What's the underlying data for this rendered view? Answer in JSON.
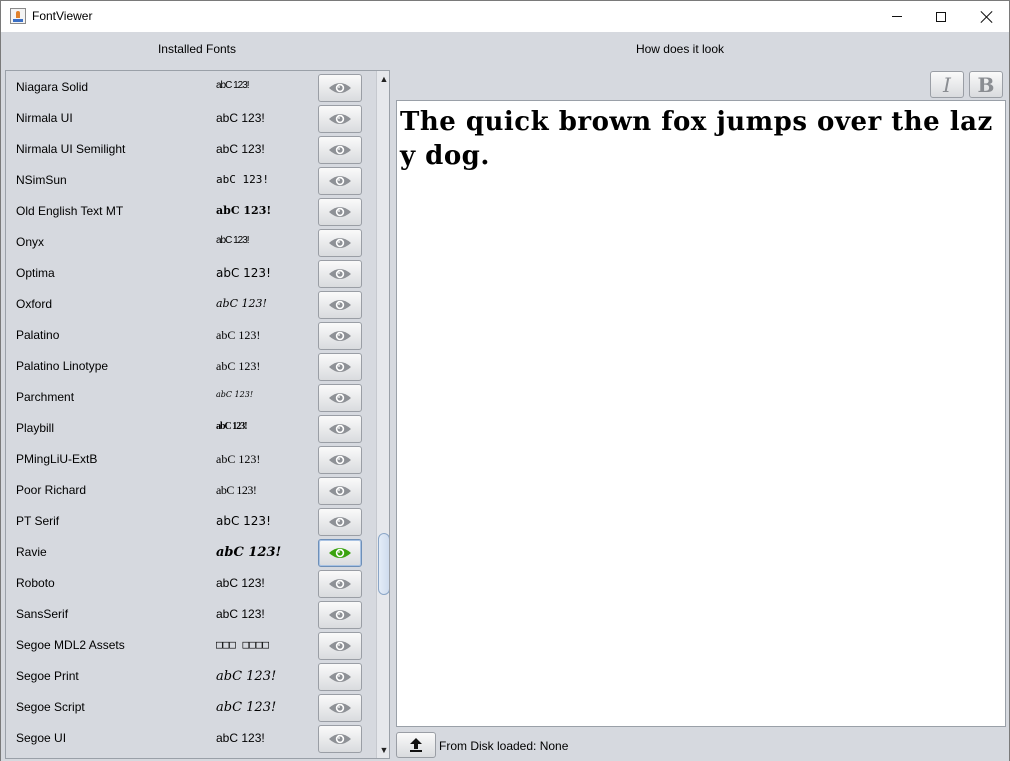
{
  "window": {
    "title": "FontViewer"
  },
  "headers": {
    "left": "Installed Fonts",
    "right": "How does it look"
  },
  "fonts": [
    {
      "name": "Niagara Solid",
      "sample": "abC 123!",
      "active": false
    },
    {
      "name": "Nirmala UI",
      "sample": "abC 123!",
      "active": false
    },
    {
      "name": "Nirmala UI Semilight",
      "sample": "abC 123!",
      "active": false
    },
    {
      "name": "NSimSun",
      "sample": "abC 123!",
      "active": false
    },
    {
      "name": "Old English Text MT",
      "sample": "abC 123!",
      "active": false
    },
    {
      "name": "Onyx",
      "sample": "abC 123!",
      "active": false
    },
    {
      "name": "Optima",
      "sample": "abC 123!",
      "active": false
    },
    {
      "name": "Oxford",
      "sample": "abC 123!",
      "active": false
    },
    {
      "name": "Palatino",
      "sample": "abC 123!",
      "active": false
    },
    {
      "name": "Palatino Linotype",
      "sample": "abC 123!",
      "active": false
    },
    {
      "name": "Parchment",
      "sample": "abC 123!",
      "active": false
    },
    {
      "name": "Playbill",
      "sample": "abC 123!",
      "active": false
    },
    {
      "name": "PMingLiU-ExtB",
      "sample": "abC 123!",
      "active": false
    },
    {
      "name": "Poor Richard",
      "sample": "abC 123!",
      "active": false
    },
    {
      "name": "PT Serif",
      "sample": "abC 123!",
      "active": false
    },
    {
      "name": "Ravie",
      "sample": "abC 123!",
      "active": true
    },
    {
      "name": "Roboto",
      "sample": "abC 123!",
      "active": false
    },
    {
      "name": "SansSerif",
      "sample": "abC 123!",
      "active": false
    },
    {
      "name": "Segoe MDL2 Assets",
      "sample": "□□□ □□□□",
      "active": false
    },
    {
      "name": "Segoe Print",
      "sample": "abC 123!",
      "active": false
    },
    {
      "name": "Segoe Script",
      "sample": "abC 123!",
      "active": false
    },
    {
      "name": "Segoe UI",
      "sample": "abC 123!",
      "active": false
    }
  ],
  "preview": {
    "text": "The quick brown fox jumps over the lazy dog."
  },
  "style_buttons": {
    "italic": "I",
    "bold": "B"
  },
  "status": {
    "text": "From Disk loaded: None"
  },
  "scrollbar": {
    "up": "▲",
    "down": "▼"
  },
  "colors": {
    "active_eye": "#3aa30f",
    "inactive_eye": "#8e9196",
    "panel_bg": "#d6d9df"
  }
}
